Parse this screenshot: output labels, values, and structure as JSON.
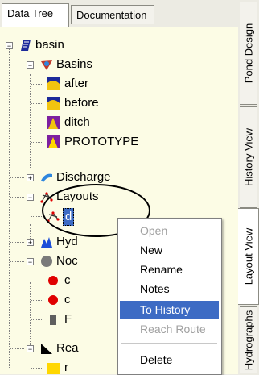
{
  "top_tabs": [
    "Data Tree",
    "Documentation"
  ],
  "side_tabs": [
    "Pond Design",
    "History View",
    "Layout View",
    "Hydrographs"
  ],
  "tree": {
    "root": "basin",
    "basins_label": "Basins",
    "basins": [
      "after",
      "before",
      "ditch",
      "PROTOTYPE"
    ],
    "discharge_label": "Discharge",
    "layouts_label": "Layouts",
    "layout_child": "d",
    "hyd_label": "Hyd",
    "nodes_label": "Noc",
    "node_children": [
      "c",
      "c",
      "F"
    ],
    "rea_label": "Rea",
    "rea_child": "r"
  },
  "context_menu": {
    "items": [
      {
        "label": "Open",
        "disabled": true
      },
      {
        "label": "New",
        "disabled": false
      },
      {
        "label": "Rename",
        "disabled": false
      },
      {
        "label": "Notes",
        "disabled": false
      },
      {
        "label": "To History",
        "disabled": false,
        "highlighted": true
      },
      {
        "label": "Reach Route",
        "disabled": true
      },
      {
        "label": "Delete",
        "disabled": false
      }
    ]
  },
  "colors": {
    "tree_background": "#fcfce5",
    "menu_highlight": "#3d6bc4",
    "basin_icon": "#1c2a9a",
    "prototype_icon": "#ffd700",
    "node_red": "#e00000"
  }
}
